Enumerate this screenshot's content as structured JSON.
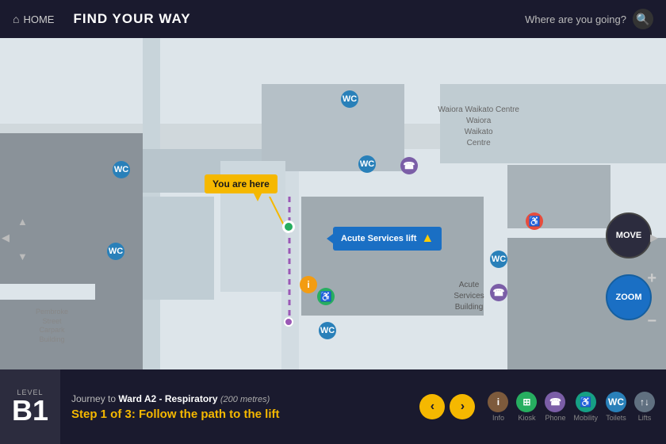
{
  "header": {
    "home_label": "HOME",
    "title": "FIND YOUR WAY",
    "search_placeholder": "Where are you going?",
    "search_label": "Where are you going?"
  },
  "map": {
    "you_are_here": "You are here",
    "lift_callout": "Acute Services lift",
    "waiora_label": "Waiora\nWaikato\nCentre",
    "acute_services_label": "Acute\nServices\nBuilding",
    "pembroke_label": "Pembroke\nStreet\nCarpark\nBuilding",
    "move_label": "MOVE",
    "zoom_label": "ZOOM"
  },
  "bottom_bar": {
    "level_text": "LEVEL",
    "level_num": "B1",
    "journey_prefix": "Journey to",
    "journey_destination": "Ward A2 - Respiratory",
    "journey_distance": "(200 metres)",
    "step_text": "Step 1 of 3:  Follow the path to the lift",
    "prev_label": "‹",
    "next_label": "›",
    "legend": [
      {
        "label": "Info",
        "icon": "i"
      },
      {
        "label": "Kiosk",
        "icon": "K"
      },
      {
        "label": "Phone",
        "icon": "P"
      },
      {
        "label": "Mobility",
        "icon": "♿"
      },
      {
        "label": "Toilets",
        "icon": "WC"
      },
      {
        "label": "Lifts",
        "icon": "↑↓"
      }
    ]
  }
}
